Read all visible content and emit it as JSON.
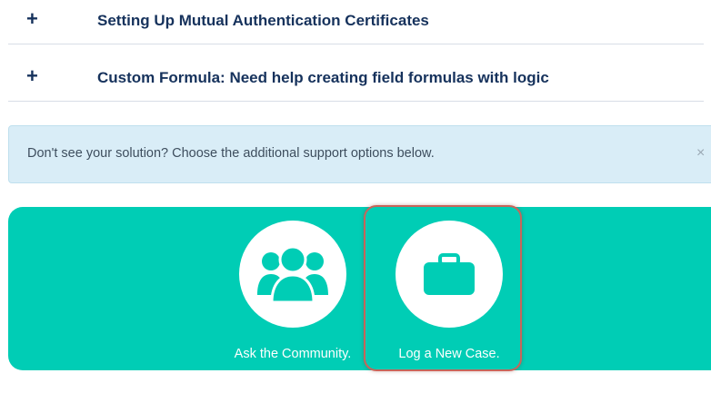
{
  "faq": {
    "items": [
      {
        "expand_glyph": "+",
        "title": "Setting Up Mutual Authentication Certificates"
      },
      {
        "expand_glyph": "+",
        "title": "Custom Formula: Need help creating field formulas with logic"
      }
    ]
  },
  "notice": {
    "message": "Don't see your solution? Choose the additional support options below.",
    "close_glyph": "×"
  },
  "support": {
    "options": [
      {
        "icon": "community-icon",
        "label": "Ask the Community."
      },
      {
        "icon": "briefcase-icon",
        "label": "Log a New Case."
      }
    ]
  },
  "colors": {
    "panel": "#00cdb5",
    "notice_bg": "#d9edf7",
    "heading_text": "#16325c",
    "highlight": "#c8655a"
  }
}
